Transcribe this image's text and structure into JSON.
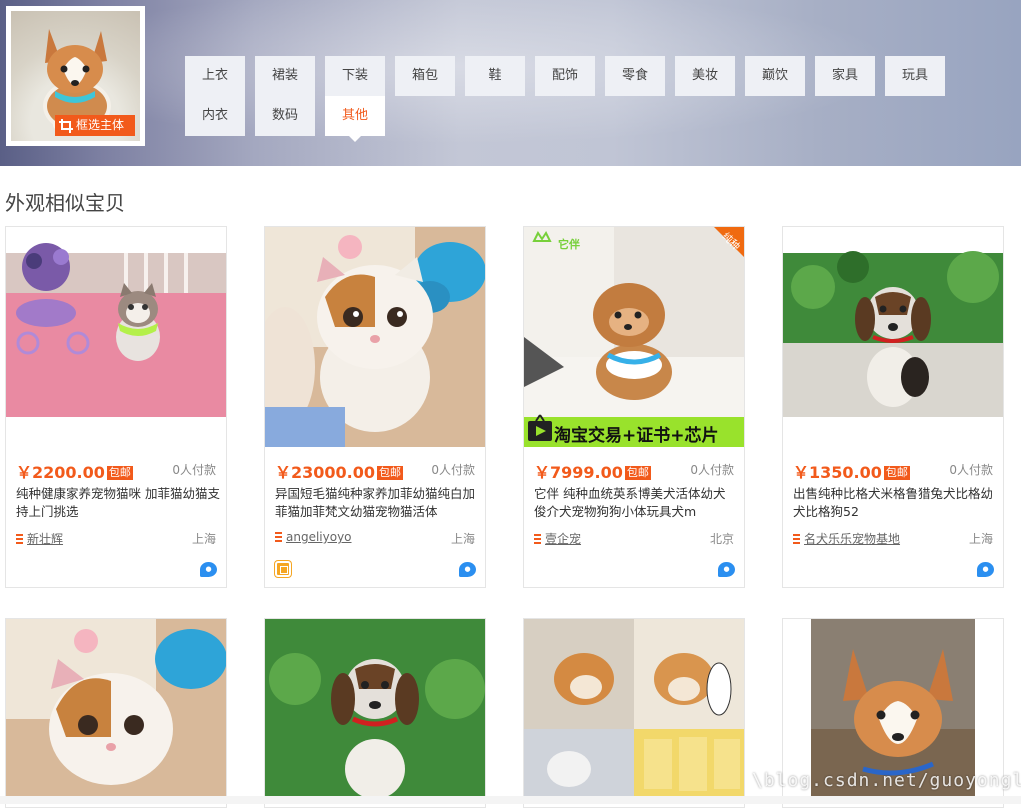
{
  "header": {
    "crop_label": "框选主体",
    "categories_row1": [
      "上衣",
      "裙装",
      "下装",
      "箱包",
      "鞋",
      "配饰",
      "零食",
      "美妆",
      "巅饮",
      "家具",
      "玩具"
    ],
    "categories_row2": [
      "内衣",
      "数码",
      "其他"
    ],
    "active_category": "其他"
  },
  "section_title": "外观相似宝贝",
  "products": [
    {
      "currency": "￥",
      "price": "2200.00",
      "badge": "包邮",
      "paid": "0人付款",
      "title": "纯种健康家养宠物猫咪 加菲猫幼猫支持上门挑选",
      "shop": "新壮辉",
      "location": "上海",
      "ww": "ww-icon"
    },
    {
      "currency": "￥",
      "price": "23000.00",
      "badge": "包邮",
      "paid": "0人付款",
      "title": "异国短毛猫纯种家养加菲幼猫纯白加菲猫加菲梵文幼猫宠物猫活体",
      "shop": "angeliyoyo",
      "location": "上海",
      "ww": "ww-icon"
    },
    {
      "currency": "￥",
      "price": "7999.00",
      "badge": "包邮",
      "paid": "0人付款",
      "title": "它伴 纯种血统英系博美犬活体幼犬 俊介犬宠物狗狗小体玩具犬m",
      "shop": "壹企宠",
      "location": "北京",
      "ww": "ww-icon",
      "image_banner": "淘宝交易+证书+芯片",
      "corner_tag": "纯种",
      "brand_mark": "它伴"
    },
    {
      "currency": "￥",
      "price": "1350.00",
      "badge": "包邮",
      "paid": "0人付款",
      "title": "出售纯种比格犬米格鲁猎兔犬比格幼犬比格狗52",
      "shop": "名犬乐乐宠物基地",
      "location": "上海",
      "ww": "ww-icon"
    }
  ],
  "watermark": "\\blog.csdn.net/guoyonglai",
  "colors": {
    "accent": "#f25a1b",
    "wangwang": "#2b8ff0"
  }
}
